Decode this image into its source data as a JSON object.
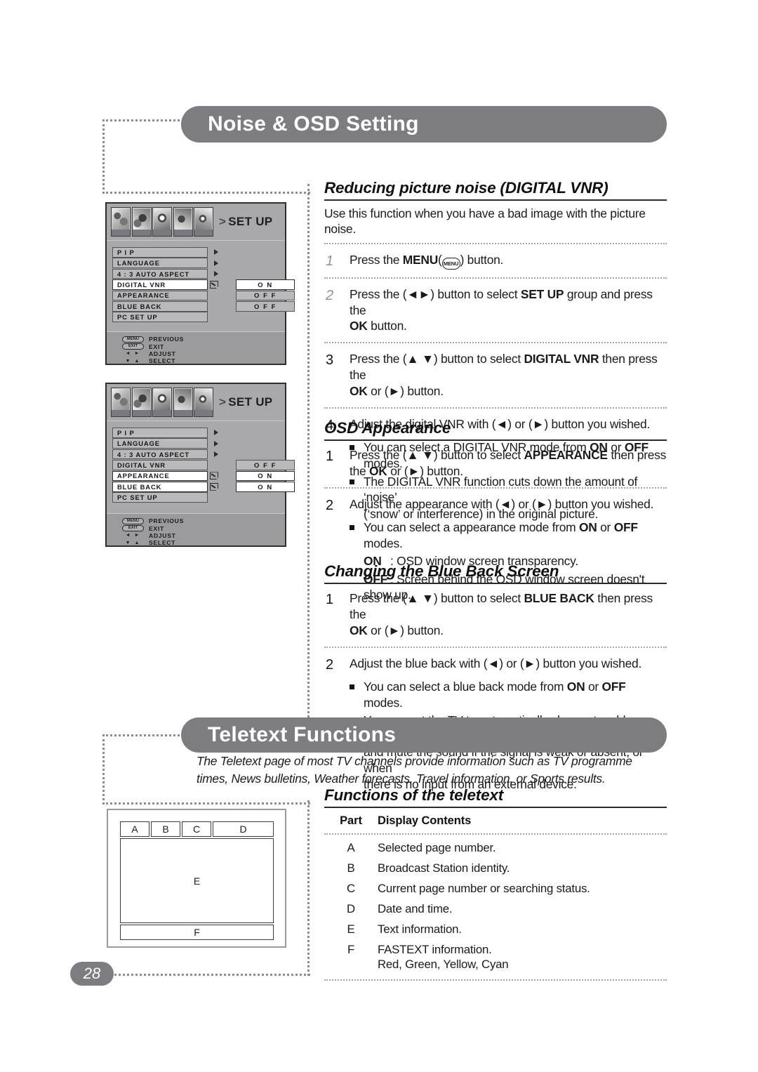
{
  "page": {
    "number": "28"
  },
  "sections": [
    {
      "title": "Noise & OSD Setting"
    },
    {
      "title": "Teletext Functions"
    }
  ],
  "osd_panels": [
    {
      "group_label": "SET UP",
      "chevron": ">",
      "rows": [
        {
          "label": "P I P",
          "arrow": true,
          "check": false,
          "selected": false,
          "value": null,
          "value_selected": false
        },
        {
          "label": "LANGUAGE",
          "arrow": true,
          "check": false,
          "selected": false,
          "value": null,
          "value_selected": false
        },
        {
          "label": "4 : 3 AUTO ASPECT",
          "arrow": true,
          "check": false,
          "selected": false,
          "value": null,
          "value_selected": false
        },
        {
          "label": "DIGITAL VNR",
          "arrow": false,
          "check": true,
          "selected": true,
          "value": "O N",
          "value_selected": true
        },
        {
          "label": "APPEARANCE",
          "arrow": false,
          "check": false,
          "selected": false,
          "value": "O F F",
          "value_selected": false
        },
        {
          "label": "BLUE BACK",
          "arrow": false,
          "check": false,
          "selected": false,
          "value": "O F F",
          "value_selected": false
        },
        {
          "label": "PC SET UP",
          "arrow": false,
          "check": false,
          "selected": false,
          "value": null,
          "value_selected": false
        }
      ],
      "legend": [
        {
          "key": "MENU",
          "text": "PREVIOUS"
        },
        {
          "key": "EXIT",
          "text": "EXIT"
        },
        {
          "key": "◄ ►",
          "text": "ADJUST"
        },
        {
          "key": "▼ ▲",
          "text": "SELECT"
        }
      ]
    },
    {
      "group_label": "SET UP",
      "chevron": ">",
      "rows": [
        {
          "label": "P I P",
          "arrow": true,
          "check": false,
          "selected": false,
          "value": null,
          "value_selected": false
        },
        {
          "label": "LANGUAGE",
          "arrow": true,
          "check": false,
          "selected": false,
          "value": null,
          "value_selected": false
        },
        {
          "label": "4 : 3 AUTO ASPECT",
          "arrow": true,
          "check": false,
          "selected": false,
          "value": null,
          "value_selected": false
        },
        {
          "label": "DIGITAL VNR",
          "arrow": false,
          "check": false,
          "selected": false,
          "value": "O F F",
          "value_selected": false
        },
        {
          "label": "APPEARANCE",
          "arrow": false,
          "check": true,
          "selected": true,
          "value": "O N",
          "value_selected": true
        },
        {
          "label": "BLUE BACK",
          "arrow": false,
          "check": true,
          "selected": true,
          "value": "O N",
          "value_selected": true
        },
        {
          "label": "PC SET UP",
          "arrow": false,
          "check": false,
          "selected": false,
          "value": null,
          "value_selected": false
        }
      ],
      "legend": [
        {
          "key": "MENU",
          "text": "PREVIOUS"
        },
        {
          "key": "EXIT",
          "text": "EXIT"
        },
        {
          "key": "◄ ►",
          "text": "ADJUST"
        },
        {
          "key": "▼ ▲",
          "text": "SELECT"
        }
      ]
    }
  ],
  "vnr": {
    "title": "Reducing  picture noise (DIGITAL VNR)",
    "intro": "Use this function when you have a bad image with the picture noise.",
    "step1_num": "1",
    "step2_num": "2",
    "step3_num": "3",
    "step4_num": "4",
    "step1_menu_label": "MENU",
    "step1_menu_key": "MENU",
    "step2_a": "Press the (◄►) button to select ",
    "step2_b": "SET UP",
    "step2_c": " group and press the",
    "step2_d": "OK",
    "step2_e": " button.",
    "step3_a": "Press the (▲ ▼) button to select ",
    "step3_b": "DIGITAL VNR",
    "step3_c": " then press the",
    "step3_d": "OK",
    "step3_e": " or (►) button.",
    "step4": "Adjust the digital VNR with (◄) or (►) button you wished.",
    "bullet1_a": "You can select a DIGITAL VNR mode from ",
    "bullet1_on": "ON",
    "bullet1_or": " or ",
    "bullet1_off": "OFF",
    "bullet1_end": " modes.",
    "bullet2_line1": "The DIGITAL VNR function cuts down the amount of ‘noise’",
    "bullet2_line2": "(‘snow’ or interference) in the original picture."
  },
  "appearance": {
    "title": "OSD Appearance",
    "step1_num": "1",
    "step2_num": "2",
    "step1_a": "Press the (▲ ▼) button to select ",
    "step1_b": "APPEARANCE",
    "step1_c": " then press",
    "step1_d": "the ",
    "step1_e": "OK",
    "step1_f": " or (►) button.",
    "step2": "Adjust the appearance with (◄) or (►) button you wished.",
    "bullet1_a": "You can select a appearance mode from ",
    "bullet1_on": "ON",
    "bullet1_or": " or ",
    "bullet1_off": "OFF",
    "bullet1_end": " modes.",
    "on_label": "ON",
    "on_text": ": OSD window screen transparency.",
    "off_label": "OFF",
    "off_text": ": Screen behind the OSD window screen doesn't show up."
  },
  "blueback": {
    "title": "Changing the Blue Back Screen",
    "step1_num": "1",
    "step2_num": "2",
    "step1_a": "Press the (▲ ▼) button to select ",
    "step1_b": "BLUE BACK",
    "step1_c": " then press the",
    "step1_d": "OK",
    "step1_e": " or (►) button.",
    "step2": "Adjust the blue back with (◄) or (►) button you wished.",
    "bullet1_a": "You can select a blue back mode from ",
    "bullet1_on": "ON",
    "bullet1_or": " or ",
    "bullet1_off": "OFF",
    "bullet1_end": " modes.",
    "bullet2_line1": "You can set the TV to automatically change to a blue screen",
    "bullet2_line2": "and mute the sound if the signal is weak or absent, or when",
    "bullet2_line3": "there is no input from an external device."
  },
  "teletext": {
    "intro_line1": "The Teletext page of most TV channels provide information such as TV programme",
    "intro_line2": "times, News bulletins, Weather forecasts, Travel information, or Sports results.",
    "functions_title": "Functions of the teletext",
    "table": {
      "headers": [
        "Part",
        "Display Contents"
      ],
      "rows": [
        {
          "part": "A",
          "contents": "Selected page number.",
          "extra": null
        },
        {
          "part": "B",
          "contents": "Broadcast Station identity.",
          "extra": null
        },
        {
          "part": "C",
          "contents": "Current page number or searching status.",
          "extra": null
        },
        {
          "part": "D",
          "contents": "Date and time.",
          "extra": null
        },
        {
          "part": "E",
          "contents": "Text information.",
          "extra": null
        },
        {
          "part": "F",
          "contents": "FASTEXT information.",
          "extra": "Red, Green, Yellow, Cyan"
        }
      ]
    },
    "diagram_cells": [
      "A",
      "B",
      "C",
      "D",
      "E",
      "F"
    ]
  },
  "colors": {
    "header_pill": "#7d7d81",
    "dotted": "#8d8d90",
    "osd_bg": "#a9a9ac",
    "osd_item": "#b9b9bc",
    "osd_selected": "#ffffff",
    "step_number_light": "#8b939b",
    "text": "#1b1b1b"
  }
}
